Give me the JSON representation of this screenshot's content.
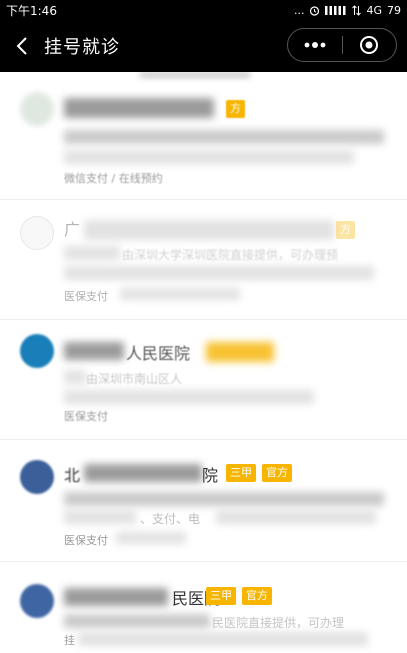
{
  "status_bar": {
    "time": "下午1:46",
    "dots": "...",
    "network": "4G",
    "battery": "79"
  },
  "nav": {
    "title": "挂号就诊"
  },
  "items": [
    {
      "pay": "微信支付 / 在线预约",
      "tags": [
        "方"
      ]
    },
    {
      "prefix": "广",
      "desc": "由深圳大学深圳医院直接提供，可办理预",
      "pay": "医保支付",
      "tags": [
        "方"
      ]
    },
    {
      "name": "人民医院",
      "desc": "由深圳市南山区人",
      "pay": "医保支付"
    },
    {
      "name_prefix": "北",
      "name": "院",
      "desc": "、支付、电",
      "pay": "医保支付",
      "tags": [
        "三甲",
        "官方"
      ]
    },
    {
      "name": "民医院",
      "desc": "民医院直接提供，可办理",
      "pay": "挂",
      "tags": [
        "三甲",
        "官方"
      ]
    }
  ]
}
